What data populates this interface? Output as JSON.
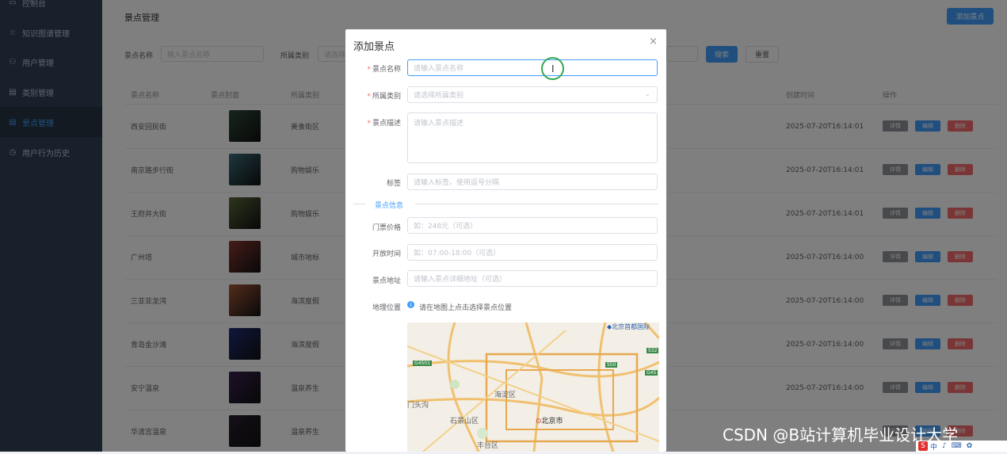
{
  "sidebar": {
    "items": [
      {
        "label": "控制台",
        "icon": "monitor-icon"
      },
      {
        "label": "知识图谱管理",
        "icon": "star-icon"
      },
      {
        "label": "用户管理",
        "icon": "user-icon"
      },
      {
        "label": "类别管理",
        "icon": "folder-icon"
      },
      {
        "label": "景点管理",
        "icon": "folder-icon"
      },
      {
        "label": "用户行为历史",
        "icon": "clock-icon"
      }
    ]
  },
  "page": {
    "title": "景点管理",
    "add_button": "添加景点",
    "search_button": "搜索",
    "reset_button": "重置"
  },
  "filters": {
    "name_label": "景点名称",
    "name_placeholder": "输入景点名称",
    "category_label": "所属类别",
    "category_placeholder": "请选择"
  },
  "table": {
    "columns": [
      "景点名称",
      "景点封面",
      "所属类别",
      "创建时间",
      "操作"
    ],
    "actions": {
      "detail": "详情",
      "edit": "编辑",
      "delete": "删除"
    },
    "rows": [
      {
        "name": "西安回民街",
        "category": "美食街区",
        "created": "2025-07-20T16:14:01",
        "thumb_color": "#2f4a3a"
      },
      {
        "name": "南京路步行街",
        "category": "购物娱乐",
        "created": "2025-07-20T16:14:01",
        "thumb_color": "#3b6e7a"
      },
      {
        "name": "王府井大街",
        "category": "购物娱乐",
        "created": "2025-07-20T16:14:01",
        "thumb_color": "#5a6a3a"
      },
      {
        "name": "广州塔",
        "category": "城市地标",
        "created": "2025-07-20T16:14:00",
        "thumb_color": "#8a3a30"
      },
      {
        "name": "三亚亚龙湾",
        "category": "海滨度假",
        "created": "2025-07-20T16:14:00",
        "thumb_color": "#a85a3a"
      },
      {
        "name": "青岛金沙滩",
        "category": "海滨度假",
        "created": "2025-07-20T16:14:00",
        "thumb_color": "#1f2f7a"
      },
      {
        "name": "安宁温泉",
        "category": "温泉养生",
        "created": "2025-07-20T16:14:00",
        "thumb_color": "#3a2050"
      },
      {
        "name": "华清宫温泉",
        "category": "温泉养生",
        "created": "",
        "thumb_color": "#2a2030"
      }
    ]
  },
  "dialog": {
    "title": "添加景点",
    "close": "×",
    "fields": {
      "name_label": "景点名称",
      "name_placeholder": "请输入景点名称",
      "category_label": "所属类别",
      "category_placeholder": "请选择所属类别",
      "desc_label": "景点描述",
      "desc_placeholder": "请输入景点描述",
      "tags_label": "标签",
      "tags_placeholder": "请输入标签，使用逗号分隔",
      "section_title": "景点信息",
      "price_label": "门票价格",
      "price_placeholder": "如：248元（可选）",
      "hours_label": "开放时间",
      "hours_placeholder": "如：07:00-18:00（可选）",
      "address_label": "景点地址",
      "address_placeholder": "请输入景点详细地址（可选）",
      "location_label": "地理位置",
      "location_hint": "请在地图上点击选择景点位置"
    },
    "map_labels": {
      "airport": "北京首都国际",
      "haidian": "海淀区",
      "beijing": "北京市",
      "shijingshan": "石景山区",
      "mentougou": "门头沟",
      "fengtai": "丰台区",
      "road_g4501": "G4501",
      "road_s32": "S32",
      "road_s50": "S50",
      "road_g45": "G45"
    }
  },
  "watermark": "CSDN @B站计算机毕业设计大学",
  "tray_text": "中",
  "colors": {
    "primary": "#409eff",
    "danger": "#f56c6c",
    "info": "#909399",
    "sidebar": "#304156"
  }
}
